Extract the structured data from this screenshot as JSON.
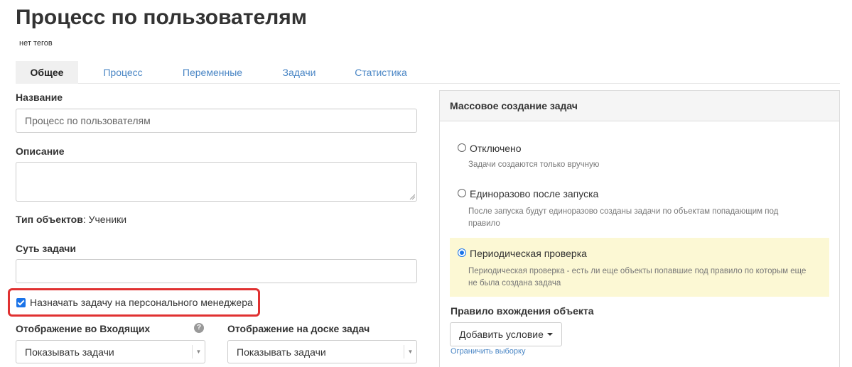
{
  "page": {
    "title": "Процесс по пользователям",
    "tags": "нет тегов"
  },
  "tabs": [
    {
      "label": "Общее"
    },
    {
      "label": "Процесс"
    },
    {
      "label": "Переменные"
    },
    {
      "label": "Задачи"
    },
    {
      "label": "Статистика"
    }
  ],
  "form": {
    "name_label": "Название",
    "name_value": "Процесс по пользователям",
    "description_label": "Описание",
    "description_value": "",
    "object_type_label": "Тип объектов",
    "object_type_value": ": Ученики",
    "task_essence_label": "Суть задачи",
    "task_essence_value": "",
    "assign_manager_label": "Назначать задачу на персонального менеджера",
    "assign_manager_checked": true,
    "inbox_display_label": "Отображение во Входящих",
    "inbox_display_value": "Показывать задачи",
    "board_display_label": "Отображение на доске задач",
    "board_display_value": "Показывать задачи",
    "help_icon": "question-circle-icon"
  },
  "mass_creation": {
    "header": "Массовое создание задач",
    "options": [
      {
        "label": "Отключено",
        "description": "Задачи создаются только вручную",
        "checked": false
      },
      {
        "label": "Единоразово после запуска",
        "description_line1": "После запуска будут единоразово созданы задачи по объектам попадающим под",
        "description_line2": "правило",
        "checked": false
      },
      {
        "label": "Периодическая проверка",
        "description_line1": "Периодическая проверка - есть ли еще объекты попавшие под правило по которым еще",
        "description_line2": "не была создана задача",
        "checked": true
      }
    ],
    "rule_label": "Правило вхождения объекта",
    "add_condition_label": "Добавить условие",
    "limit_link": "Ограничить выборку"
  },
  "colors": {
    "accent": "#1a73e8",
    "link": "#4a86c5",
    "highlight_box": "#e03131",
    "selected_option_bg": "#fcf8d4"
  }
}
